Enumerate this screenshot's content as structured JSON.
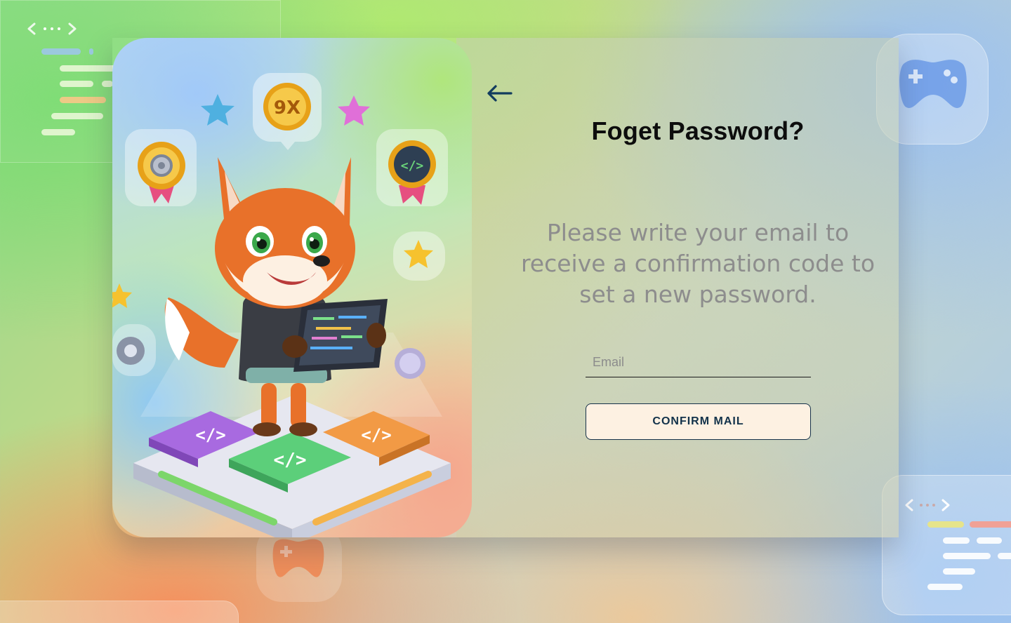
{
  "form": {
    "title": "Foget Password?",
    "subtitle": "Please write your email to receive a confirmation code to set a new password.",
    "email_placeholder": "Email",
    "email_value": "",
    "confirm_label": "CONFIRM MAIL"
  },
  "illustration": {
    "coin_label": "9X",
    "badge_code_label": "</>",
    "tile_labels": [
      "</>",
      "</>",
      "</>"
    ]
  },
  "icons": {
    "back": "arrow-left-icon",
    "gamepad": "gamepad-icon",
    "code": "code-brackets-icon"
  },
  "colors": {
    "accent_dark": "#12324a",
    "button_bg": "#fdf1e2",
    "title": "#0d0d0d",
    "subtitle": "#8d8d8d",
    "fox_orange": "#e8712a"
  }
}
